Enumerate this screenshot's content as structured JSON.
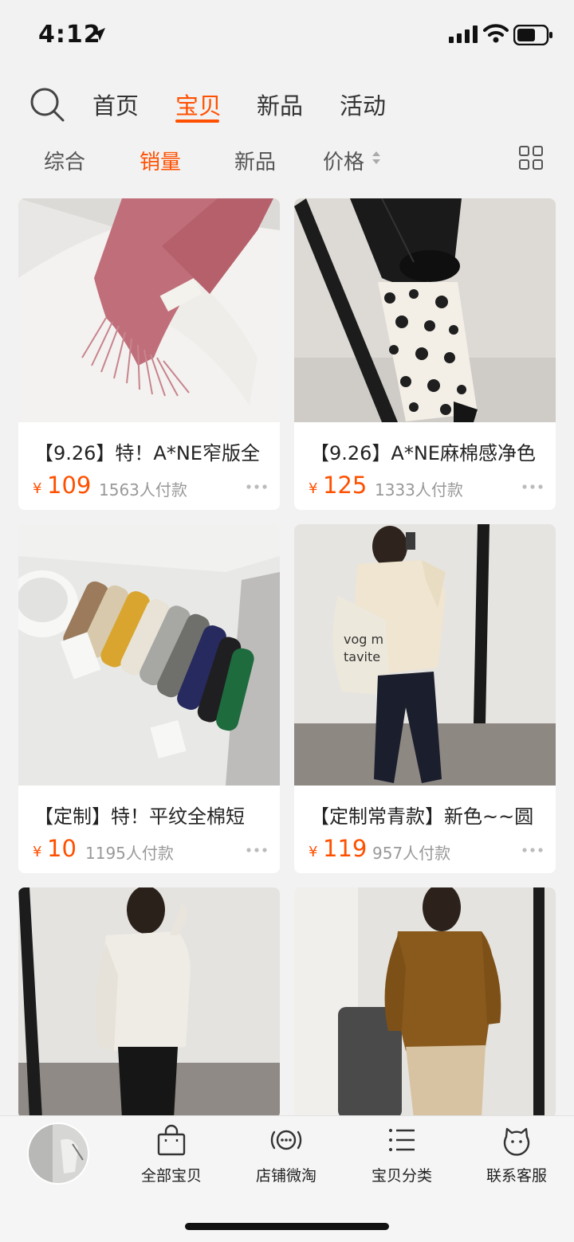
{
  "status_bar": {
    "time": "4:12"
  },
  "top_nav": {
    "tabs": [
      {
        "label": "首页"
      },
      {
        "label": "宝贝"
      },
      {
        "label": "新品"
      },
      {
        "label": "活动"
      }
    ],
    "active_tab": "宝贝"
  },
  "sort_bar": {
    "items": [
      {
        "label": "综合"
      },
      {
        "label": "销量"
      },
      {
        "label": "新品"
      },
      {
        "label": "价格"
      }
    ],
    "active": "销量"
  },
  "products": [
    {
      "title": "【9.26】特！A*NE窄版全",
      "currency": "¥",
      "price": "109",
      "sales": "1563人付款"
    },
    {
      "title": "【9.26】A*NE麻棉感净色",
      "currency": "¥",
      "price": "125",
      "sales": "1333人付款"
    },
    {
      "title": "【定制】特！平纹全棉短",
      "currency": "¥",
      "price": "10",
      "sales": "1195人付款"
    },
    {
      "title": "【定制常青款】新色~~圆",
      "currency": "¥",
      "price": "119",
      "sales": "957人付款"
    }
  ],
  "bottom_bar": {
    "items": [
      {
        "label": "全部宝贝",
        "icon": "shopping-bag-icon"
      },
      {
        "label": "店铺微淘",
        "icon": "broadcast-icon"
      },
      {
        "label": "宝贝分类",
        "icon": "list-icon"
      },
      {
        "label": "联系客服",
        "icon": "customer-service-icon"
      }
    ]
  },
  "colors": {
    "accent": "#ff5000",
    "background": "#f2f2f2"
  }
}
